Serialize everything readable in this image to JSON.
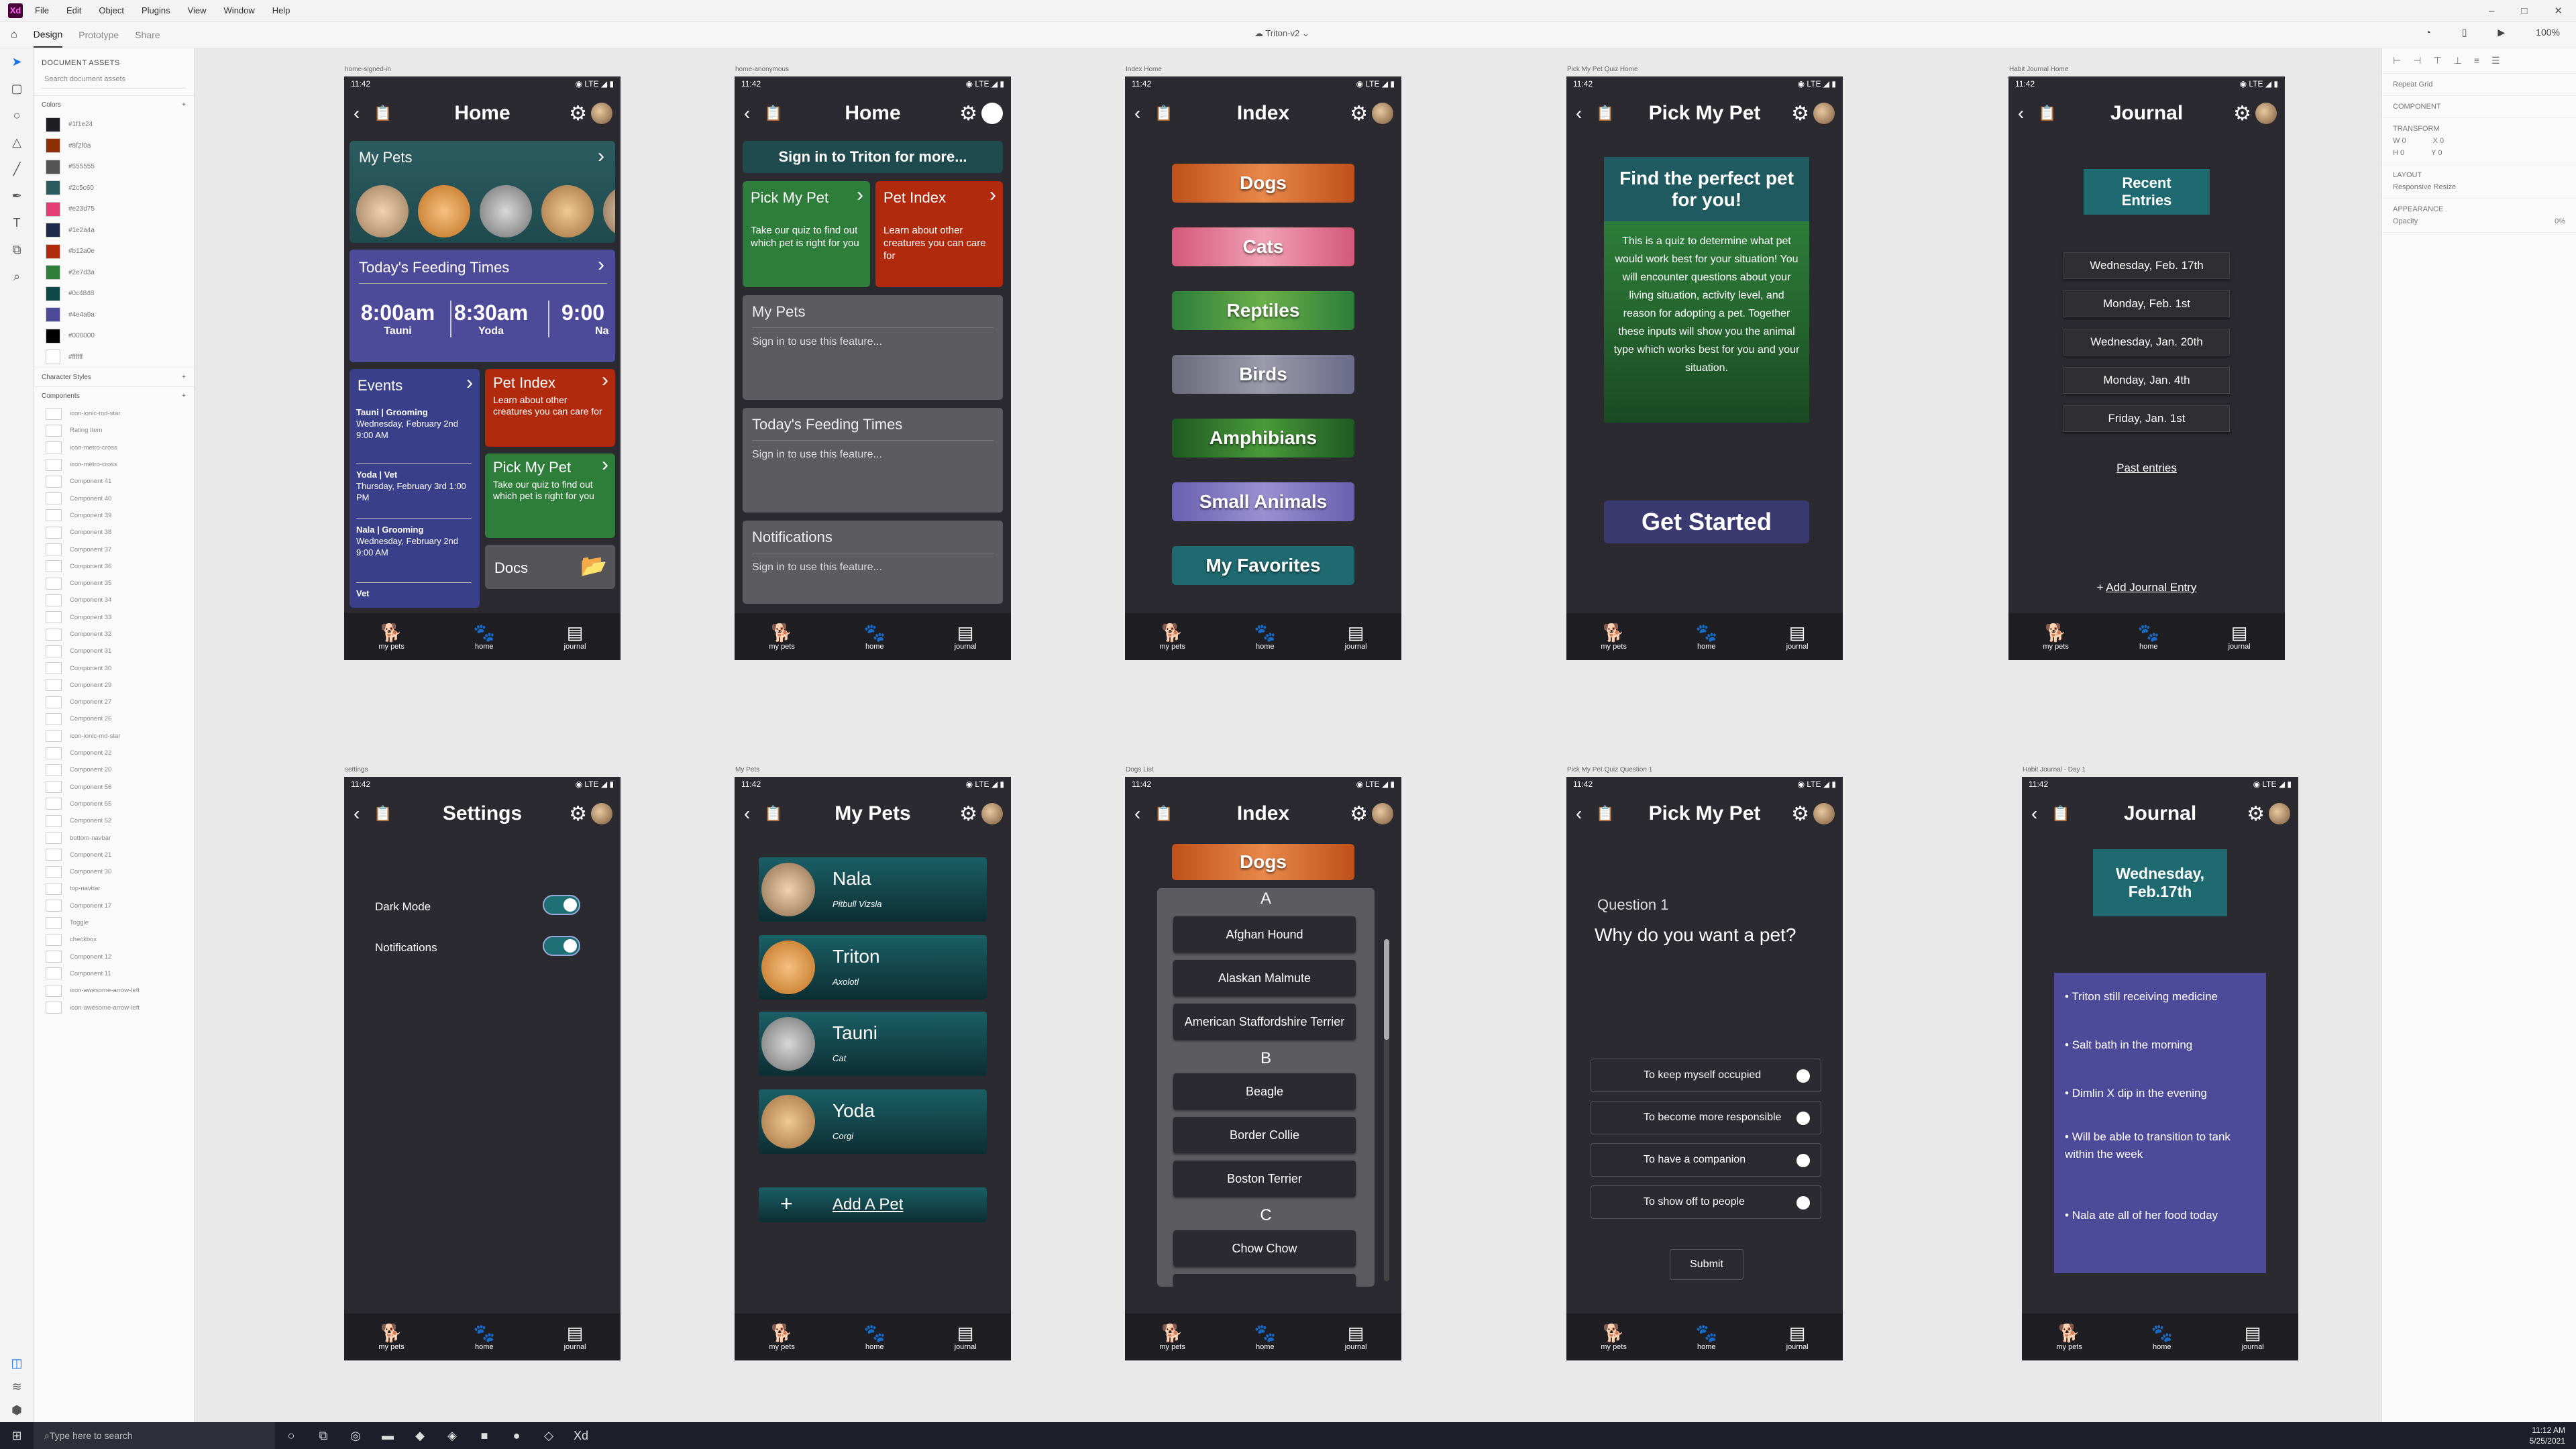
{
  "app": {
    "menu": [
      "File",
      "Edit",
      "Object",
      "Plugins",
      "View",
      "Window",
      "Help"
    ],
    "tabs": [
      "Design",
      "Prototype",
      "Share"
    ],
    "doc_title": "Triton-v2",
    "zoom": "100%"
  },
  "assets": {
    "title": "DOCUMENT ASSETS",
    "search_placeholder": "Search document assets",
    "colors_label": "Colors",
    "char_styles_label": "Character Styles",
    "components_label": "Components",
    "colors": [
      {
        "hex": "#1F1E24"
      },
      {
        "hex": "#8F2F0A"
      },
      {
        "hex": "#555555"
      },
      {
        "hex": "#2C5C60"
      },
      {
        "hex": "#E23D75"
      },
      {
        "hex": "#1E2A4A"
      },
      {
        "hex": "#B12A0E"
      },
      {
        "hex": "#2E7D3A"
      },
      {
        "hex": "#0C4848"
      },
      {
        "hex": "#4E4A9A"
      },
      {
        "hex": "#000000"
      },
      {
        "hex": "#FFFFFF"
      }
    ],
    "color_labels": [
      "#1f1e24",
      "#8f2f0a",
      "#555555",
      "#2c5c60",
      "#e23d75",
      "#1e2a4a",
      "#b12a0e",
      "#2e7d3a",
      "#0c4848",
      "#4e4a9a",
      "#000000",
      "#ffffff"
    ],
    "components": [
      "icon-ionic-md-star",
      "Rating Item",
      "icon-metro-cross",
      "icon-metro-cross",
      "Component 41",
      "Component 40",
      "Component 39",
      "Component 38",
      "Component 37",
      "Component 36",
      "Component 35",
      "Component 34",
      "Component 33",
      "Component 32",
      "Component 31",
      "Component 30",
      "Component 29",
      "Component 27",
      "Component 26",
      "icon-ionic-md-star",
      "Component 22",
      "Component 20",
      "Component 56",
      "Component 55",
      "Component 52",
      "bottom-navbar",
      "Component 21",
      "Component 30",
      "top-navbar",
      "Component 17",
      "Toggle",
      "checkbox",
      "Component 12",
      "Component 11",
      "icon-awesome-arrow-left",
      "icon-awesome-arrow-left"
    ]
  },
  "props": {
    "repeat_grid": "Repeat Grid",
    "component": "COMPONENT",
    "transform": "TRANSFORM",
    "w": "W 0",
    "x": "X 0",
    "h": "H 0",
    "y": "Y 0",
    "layout": "LAYOUT",
    "responsive": "Responsive Resize",
    "appearance": "APPEARANCE",
    "opacity": "Opacity",
    "opacity_val": "0%"
  },
  "taskbar": {
    "search": "Type here to search",
    "time": "11:12 AM",
    "date": "5/25/2021"
  },
  "status": {
    "time": "11:42",
    "net": "LTE"
  },
  "nav": {
    "pets": "my pets",
    "home": "home",
    "journal": "journal"
  },
  "artboards": {
    "home_signed_in": {
      "label": "home-signed-in",
      "title": "Home",
      "my_pets": "My Pets",
      "feeding": "Today's Feeding Times",
      "times": [
        {
          "t": "8:00am",
          "n": "Tauni"
        },
        {
          "t": "8:30am",
          "n": "Yoda"
        },
        {
          "t": "9:00",
          "n": "Na"
        }
      ],
      "events": "Events",
      "ev": [
        {
          "h": "Tauni | Grooming",
          "d": "Wednesday, February 2nd 9:00 AM"
        },
        {
          "h": "Yoda | Vet",
          "d": "Thursday, February 3rd 1:00 PM"
        },
        {
          "h": "Nala | Grooming",
          "d": "Wednesday, February 2nd 9:00 AM"
        },
        {
          "h": "Vet",
          "d": ""
        }
      ],
      "pet_index": "Pet Index",
      "pet_index_desc": "Learn about other creatures you can care for",
      "pick": "Pick My Pet",
      "pick_desc": "Take our quiz to find out which pet is right for you",
      "docs": "Docs"
    },
    "home_anon": {
      "label": "home-anonymous",
      "title": "Home",
      "signin": "Sign in to Triton for more...",
      "pick": "Pick My Pet",
      "pick_desc": "Take our quiz to find out which pet is right for you",
      "pet_index": "Pet Index",
      "pet_index_desc": "Learn about other creatures you can care for",
      "cards": [
        {
          "h": "My Pets",
          "s": "Sign in to use this feature..."
        },
        {
          "h": "Today's Feeding Times",
          "s": "Sign in to use this feature..."
        },
        {
          "h": "Notifications",
          "s": "Sign in to use this feature..."
        }
      ]
    },
    "index_home": {
      "label": "Index Home",
      "title": "Index",
      "items": [
        "Dogs",
        "Cats",
        "Reptiles",
        "Birds",
        "Amphibians",
        "Small Animals",
        "My Favorites"
      ]
    },
    "quiz_home": {
      "label": "Pick My Pet Quiz Home",
      "title": "Pick My Pet",
      "heading": "Find the perfect pet for you!",
      "body": "This is a quiz to determine what pet would work best for your situation! You will encounter questions about your living situation, activity level, and reason for adopting a pet. Together these inputs will show you the animal type which works best for you and your situation.",
      "cta": "Get Started"
    },
    "journal_home": {
      "label": "Habit Journal Home",
      "title": "Journal",
      "recent": "Recent Entries",
      "dates": [
        "Wednesday, Feb. 17th",
        "Monday, Feb. 1st",
        "Wednesday, Jan. 20th",
        "Monday, Jan. 4th",
        "Friday, Jan. 1st"
      ],
      "past": "Past entries",
      "add": "Add Journal Entry"
    },
    "settings": {
      "label": "settings",
      "title": "Settings",
      "dark": "Dark Mode",
      "notif": "Notifications"
    },
    "my_pets": {
      "label": "My Pets",
      "title": "My Pets",
      "pets": [
        {
          "n": "Nala",
          "b": "Pitbull Vizsla"
        },
        {
          "n": "Triton",
          "b": "Axolotl"
        },
        {
          "n": "Tauni",
          "b": "Cat"
        },
        {
          "n": "Yoda",
          "b": "Corgi"
        }
      ],
      "add": "Add A Pet"
    },
    "dogs_list": {
      "label": "Dogs List",
      "title": "Index",
      "dogs": "Dogs",
      "sections": [
        {
          "l": "A",
          "items": [
            "Afghan Hound",
            "Alaskan Malmute",
            "American Staffordshire Terrier"
          ]
        },
        {
          "l": "B",
          "items": [
            "Beagle",
            "Border Collie",
            "Boston Terrier"
          ]
        },
        {
          "l": "C",
          "items": [
            "Chow Chow"
          ]
        }
      ]
    },
    "quiz_q1": {
      "label": "Pick My Pet Quiz Question 1",
      "title": "Pick My Pet",
      "qnum": "Question 1",
      "q": "Why do you want a pet?",
      "opts": [
        "To keep myself occupied",
        "To become more responsible",
        "To have a companion",
        "To show off to people"
      ],
      "submit": "Submit"
    },
    "journal_day": {
      "label": "Habit Journal - Day 1",
      "title": "Journal",
      "date": "Wednesday, Feb.17th",
      "entries": [
        "Triton still receiving medicine",
        "Salt bath in the morning",
        "Dimlin X dip in the evening",
        "Will be able to transition to tank within the week",
        "Nala ate all of her food today"
      ]
    }
  }
}
